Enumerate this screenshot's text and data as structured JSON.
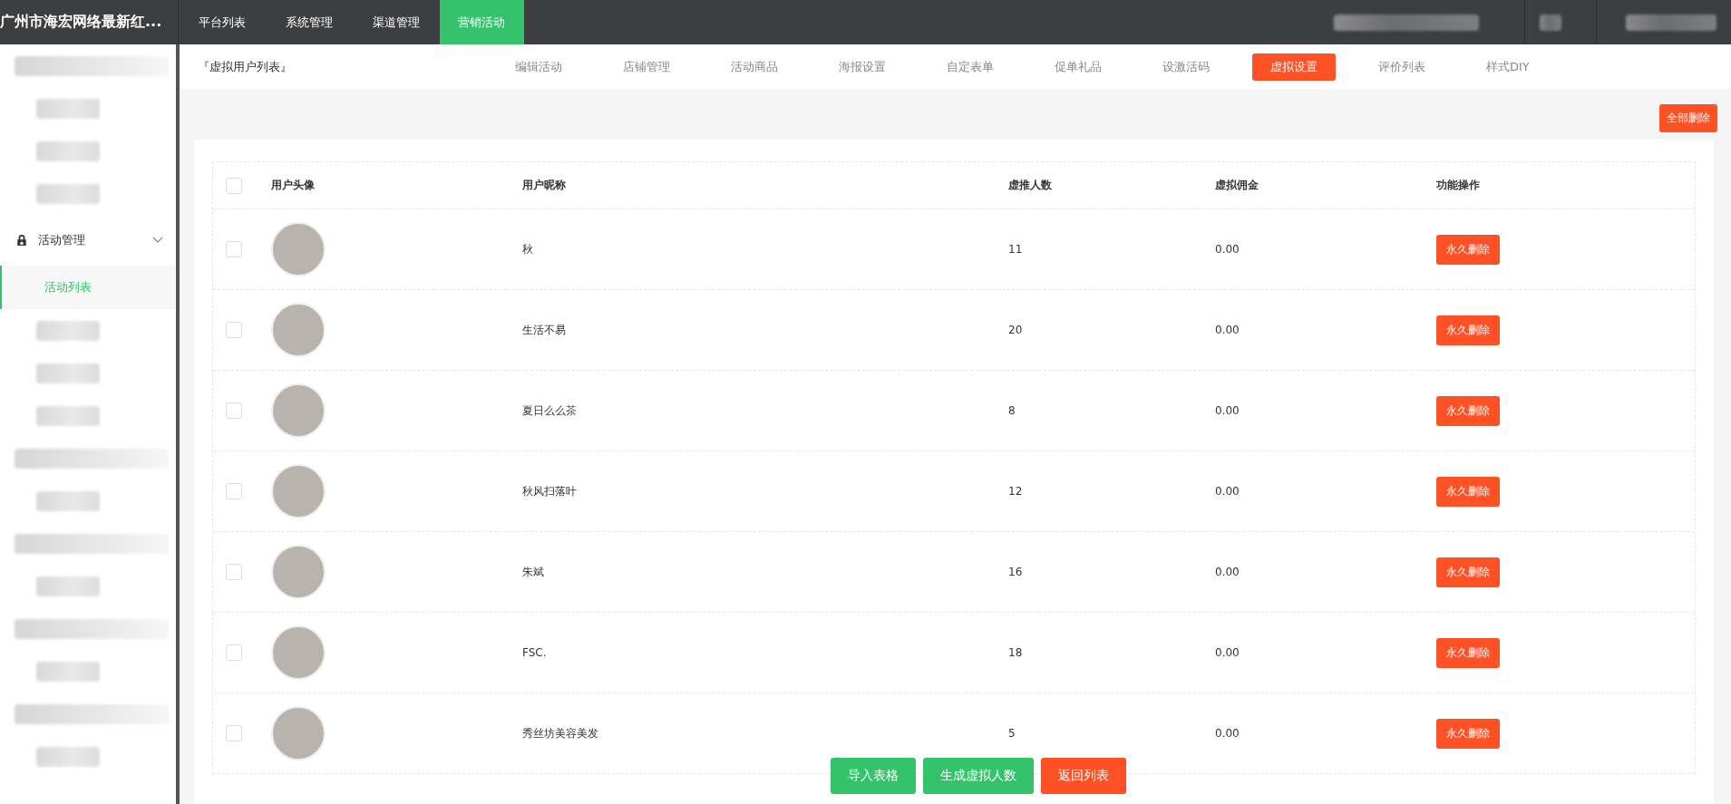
{
  "topbar": {
    "brand": "广州市海宏网络最新红...",
    "nav": [
      {
        "label": "平台列表",
        "selected": false
      },
      {
        "label": "系统管理",
        "selected": false
      },
      {
        "label": "渠道管理",
        "selected": false
      },
      {
        "label": "营销活动",
        "selected": true
      }
    ]
  },
  "sidebar": {
    "items": [
      {
        "kind": "blurred",
        "children": [
          {
            "kind": "blurred"
          },
          {
            "kind": "blurred"
          },
          {
            "kind": "blurred"
          }
        ]
      },
      {
        "kind": "group",
        "label": "活动管理",
        "expanded": true,
        "children": [
          {
            "kind": "item",
            "label": "活动列表",
            "selected": true
          },
          {
            "kind": "blurred"
          },
          {
            "kind": "blurred"
          },
          {
            "kind": "blurred"
          }
        ]
      },
      {
        "kind": "blurred",
        "children": [
          {
            "kind": "blurred"
          }
        ]
      },
      {
        "kind": "blurred",
        "children": [
          {
            "kind": "blurred"
          }
        ]
      },
      {
        "kind": "blurred",
        "children": [
          {
            "kind": "blurred"
          }
        ]
      },
      {
        "kind": "blurred",
        "children": [
          {
            "kind": "blurred"
          }
        ]
      }
    ]
  },
  "subnav": {
    "title": "『虚拟用户列表』",
    "tabs": [
      {
        "label": "编辑活动",
        "selected": false
      },
      {
        "label": "店铺管理",
        "selected": false
      },
      {
        "label": "活动商品",
        "selected": false
      },
      {
        "label": "海报设置",
        "selected": false
      },
      {
        "label": "自定表单",
        "selected": false
      },
      {
        "label": "促单礼品",
        "selected": false
      },
      {
        "label": "设激活码",
        "selected": false
      },
      {
        "label": "虚拟设置",
        "selected": true
      },
      {
        "label": "评价列表",
        "selected": false
      },
      {
        "label": "样式DIY",
        "selected": false
      }
    ]
  },
  "delete_all_button": "全部删除",
  "table": {
    "select_all": {
      "checked": false
    },
    "columns": [
      "用户头像",
      "用户昵称",
      "虚推人数",
      "虚拟佣金",
      "功能操作"
    ],
    "rows": [
      {
        "checked": false,
        "nickname": "秋",
        "count": "11",
        "commission": "0.00",
        "action": "永久删除"
      },
      {
        "checked": false,
        "nickname": "生活不易",
        "count": "20",
        "commission": "0.00",
        "action": "永久删除"
      },
      {
        "checked": false,
        "nickname": "夏日么么茶",
        "count": "8",
        "commission": "0.00",
        "action": "永久删除"
      },
      {
        "checked": false,
        "nickname": "秋风扫落叶",
        "count": "12",
        "commission": "0.00",
        "action": "永久删除"
      },
      {
        "checked": false,
        "nickname": "朱斌",
        "count": "16",
        "commission": "0.00",
        "action": "永久删除"
      },
      {
        "checked": false,
        "nickname": "FSC.",
        "count": "18",
        "commission": "0.00",
        "action": "永久删除"
      },
      {
        "checked": false,
        "nickname": "秀丝坊美容美发",
        "count": "5",
        "commission": "0.00",
        "action": "永久删除"
      }
    ]
  },
  "footer_buttons": [
    {
      "label": "导入表格",
      "kind": "primary"
    },
    {
      "label": "生成虚拟人数",
      "kind": "primary"
    },
    {
      "label": "返回列表",
      "kind": "danger"
    }
  ]
}
